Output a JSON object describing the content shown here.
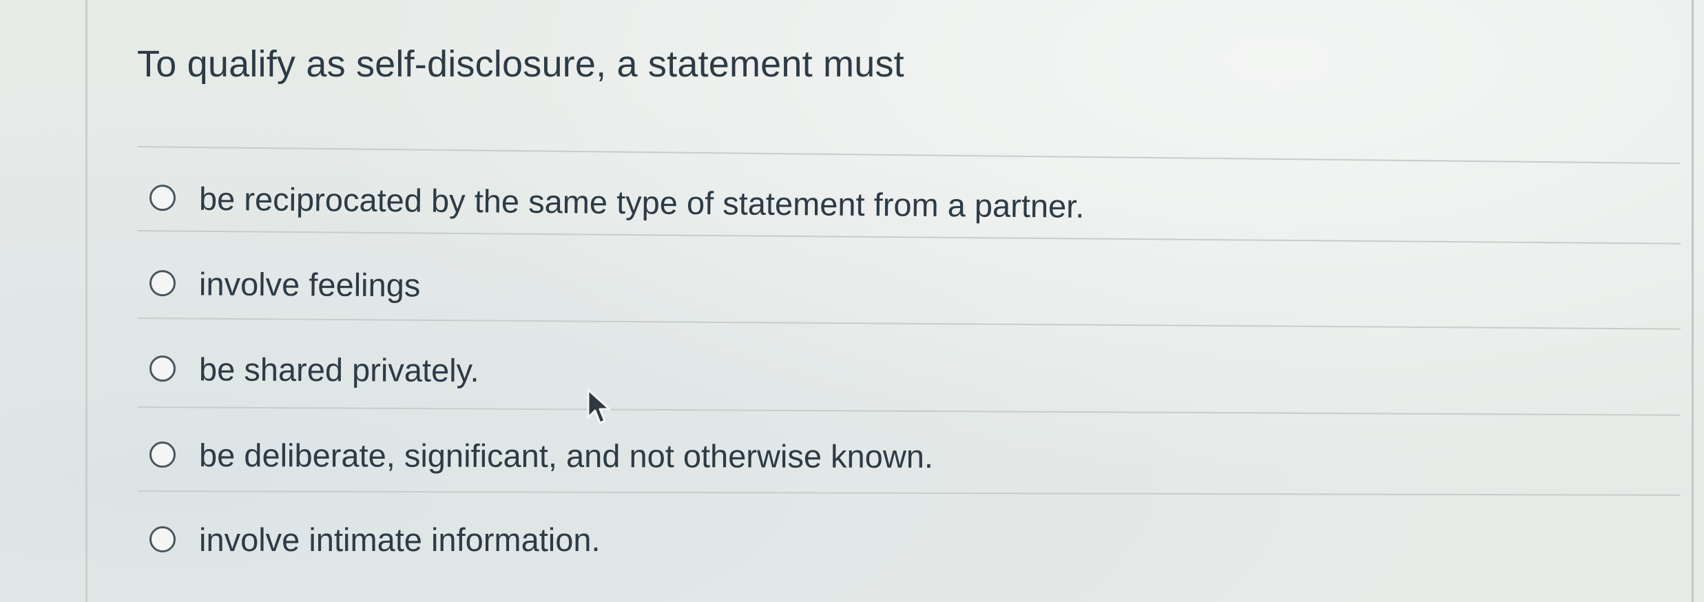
{
  "question": {
    "text": "To qualify as self-disclosure, a statement must"
  },
  "answers": [
    {
      "label": "be reciprocated by the same type of statement from a partner.",
      "selected": false
    },
    {
      "label": "involve feelings",
      "selected": false
    },
    {
      "label": "be shared privately.",
      "selected": false
    },
    {
      "label": "be deliberate, significant, and not otherwise known.",
      "selected": false
    },
    {
      "label": "involve intimate information.",
      "selected": false
    }
  ],
  "icons": {
    "radio": "radio-button-icon",
    "cursor": "mouse-pointer-icon"
  },
  "colors": {
    "text": "#2d3b45",
    "background": "#e7ebe8",
    "divider": "#c7cdca",
    "radio_border": "#4a565e"
  }
}
